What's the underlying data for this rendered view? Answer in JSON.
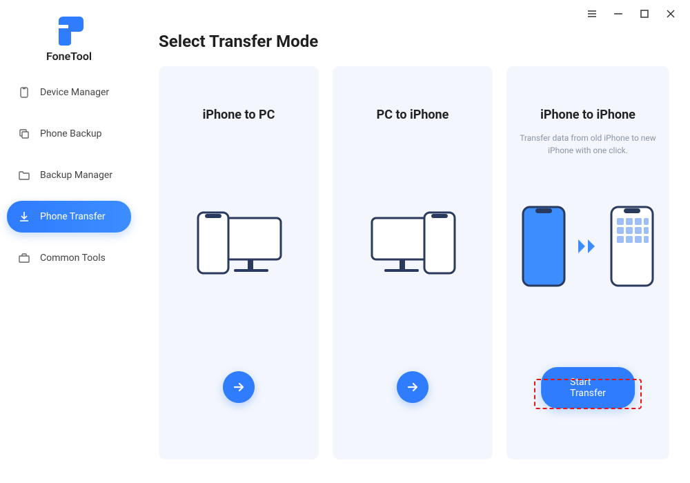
{
  "app": {
    "name": "FoneTool"
  },
  "sidebar": {
    "items": [
      {
        "label": "Device Manager",
        "icon": "phone-device-icon"
      },
      {
        "label": "Phone Backup",
        "icon": "copy-icon"
      },
      {
        "label": "Backup Manager",
        "icon": "folder-icon"
      },
      {
        "label": "Phone Transfer",
        "icon": "download-icon"
      },
      {
        "label": "Common Tools",
        "icon": "toolbox-icon"
      }
    ],
    "active_index": 3
  },
  "page": {
    "title": "Select Transfer Mode"
  },
  "cards": [
    {
      "title": "iPhone to PC",
      "description": "",
      "action_type": "arrow"
    },
    {
      "title": "PC to iPhone",
      "description": "",
      "action_type": "arrow"
    },
    {
      "title": "iPhone to iPhone",
      "description": "Transfer data from old iPhone to new iPhone with one click.",
      "action_type": "button",
      "action_label": "Start Transfer"
    }
  ]
}
